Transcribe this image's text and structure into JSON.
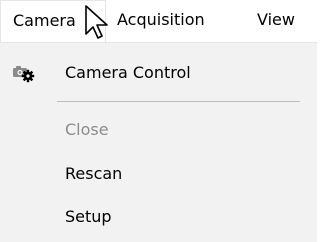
{
  "menubar": {
    "items": [
      {
        "label": "Camera"
      },
      {
        "label": "Acquisition"
      },
      {
        "label": "View"
      }
    ]
  },
  "dropdown": {
    "items": [
      {
        "label": "Camera Control",
        "icon": "camera-gear-icon",
        "enabled": true
      },
      {
        "label": "Close",
        "enabled": false
      },
      {
        "label": "Rescan",
        "enabled": true
      },
      {
        "label": "Setup",
        "enabled": true
      }
    ]
  },
  "colors": {
    "menu_background": "#f2f2f2",
    "disabled_text": "#8c8c8c",
    "separator": "#bcbcbc"
  }
}
